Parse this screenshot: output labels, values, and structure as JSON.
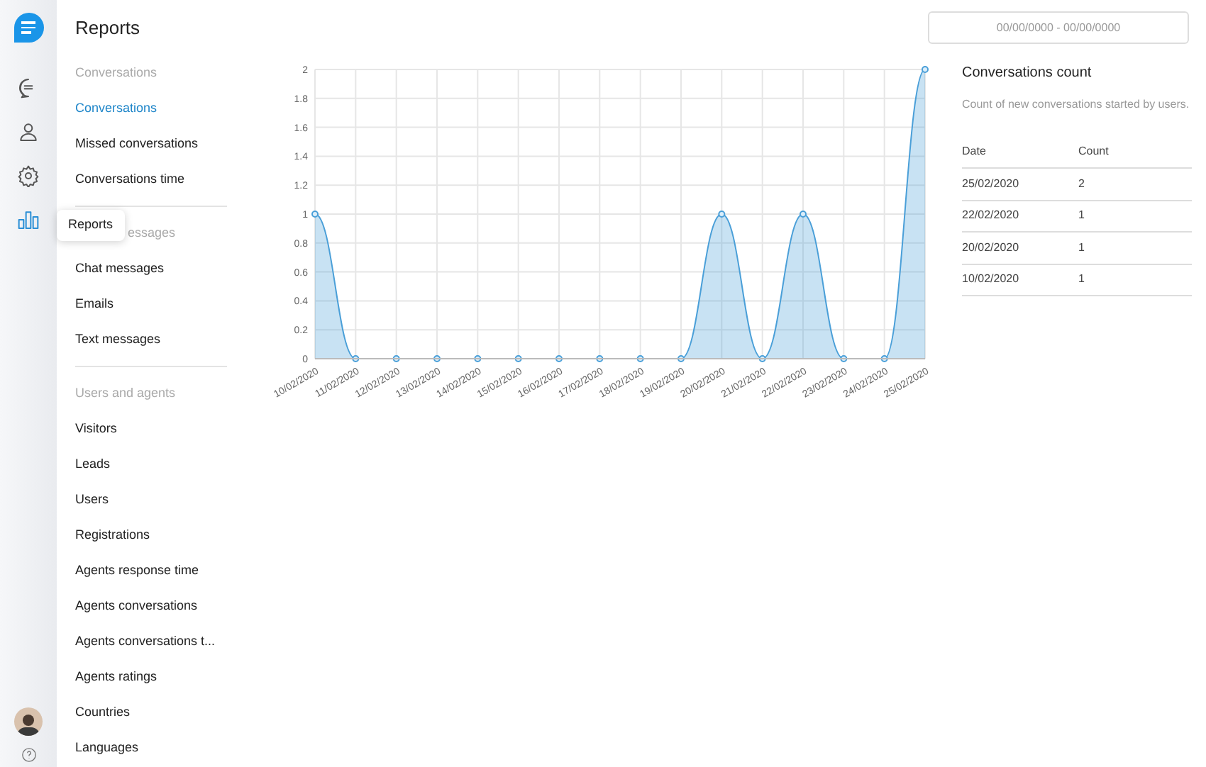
{
  "rail": {
    "items": [
      {
        "kind": "chat",
        "selected": false
      },
      {
        "kind": "user",
        "selected": false
      },
      {
        "kind": "settings",
        "selected": false
      },
      {
        "kind": "reports",
        "selected": true
      }
    ]
  },
  "tooltip": {
    "text": "Reports"
  },
  "title": "Reports",
  "date_range": {
    "placeholder": "00/00/0000 - 00/00/0000"
  },
  "nav": [
    {
      "header": "Conversations",
      "items": [
        {
          "label": "Conversations",
          "selected": true
        },
        {
          "label": "Missed conversations",
          "selected": false
        },
        {
          "label": "Conversations time",
          "selected": false
        }
      ]
    },
    {
      "header": "essages",
      "partly_hidden": true,
      "items": [
        {
          "label": "Chat messages",
          "selected": false
        },
        {
          "label": "Emails",
          "selected": false
        },
        {
          "label": "Text messages",
          "selected": false
        }
      ]
    },
    {
      "header": "Users and agents",
      "items": [
        {
          "label": "Visitors",
          "selected": false
        },
        {
          "label": "Leads",
          "selected": false
        },
        {
          "label": "Users",
          "selected": false
        },
        {
          "label": "Registrations",
          "selected": false
        },
        {
          "label": "Agents response time",
          "selected": false
        },
        {
          "label": "Agents conversations",
          "selected": false
        },
        {
          "label": "Agents conversations t...",
          "selected": false
        },
        {
          "label": "Agents ratings",
          "selected": false
        },
        {
          "label": "Countries",
          "selected": false
        },
        {
          "label": "Languages",
          "selected": false
        }
      ]
    }
  ],
  "chart_data": {
    "type": "area",
    "categories": [
      "10/02/2020",
      "11/02/2020",
      "12/02/2020",
      "13/02/2020",
      "14/02/2020",
      "15/02/2020",
      "16/02/2020",
      "17/02/2020",
      "18/02/2020",
      "19/02/2020",
      "20/02/2020",
      "21/02/2020",
      "22/02/2020",
      "23/02/2020",
      "24/02/2020",
      "25/02/2020"
    ],
    "grid": true,
    "series": [
      {
        "color": "#4a9fd8",
        "values": [
          1,
          0,
          0,
          0,
          0,
          0,
          0,
          0,
          0,
          0,
          1,
          0,
          1,
          0,
          0,
          2
        ]
      }
    ],
    "ylim": [
      0,
      2
    ],
    "yticks": [
      0,
      0.2,
      0.4,
      0.6,
      0.8,
      1,
      1.2,
      1.4,
      1.6,
      1.8,
      2
    ]
  },
  "panel": {
    "title": "Conversations count",
    "description": "Count of new conversations started by users.",
    "columns": [
      "Date",
      "Count"
    ],
    "rows": [
      [
        "25/02/2020",
        "2"
      ],
      [
        "22/02/2020",
        "1"
      ],
      [
        "20/02/2020",
        "1"
      ],
      [
        "10/02/2020",
        "1"
      ]
    ]
  }
}
